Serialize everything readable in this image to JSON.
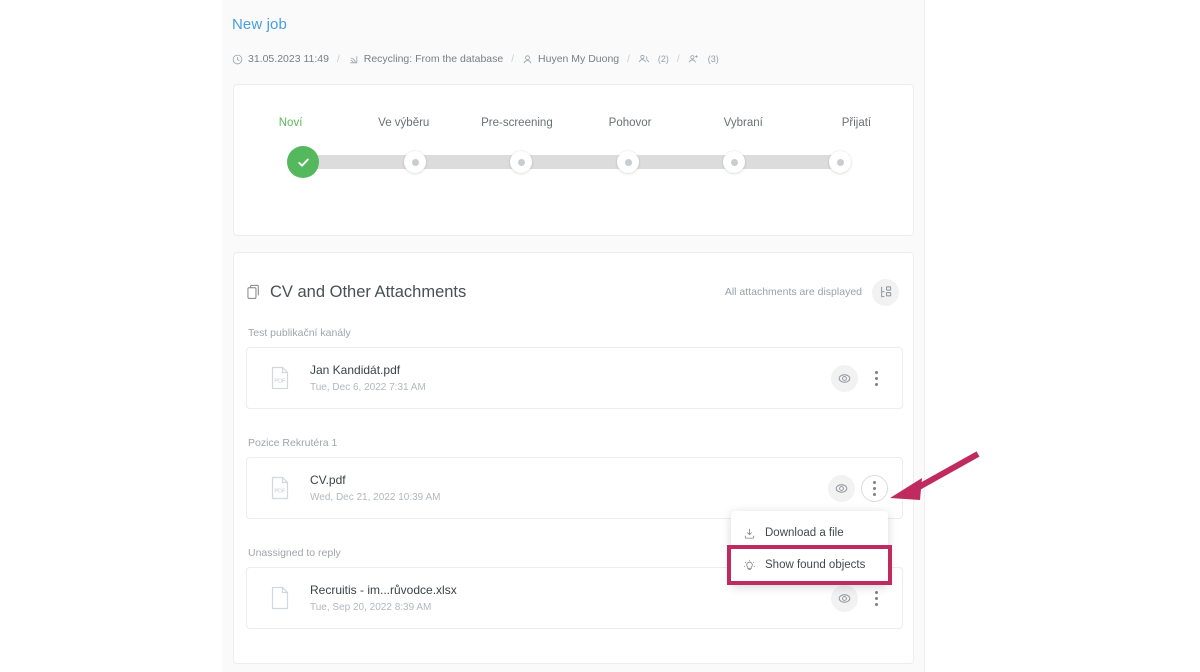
{
  "header": {
    "job_title": "New job",
    "breadcrumb": [
      {
        "icon": "clock-icon",
        "label": "31.05.2023 11:49",
        "count": ""
      },
      {
        "icon": "rss-feed-icon",
        "label": "Recycling: From the database",
        "count": ""
      },
      {
        "icon": "user-icon",
        "label": "Huyen My Duong",
        "count": ""
      },
      {
        "icon": "users-icon",
        "label": "",
        "count": "(2)"
      },
      {
        "icon": "user-add-icon",
        "label": "",
        "count": "(3)"
      }
    ],
    "separator": "/"
  },
  "stepper": {
    "active_index": 0,
    "active_color": "#5cb85c",
    "steps": [
      {
        "label": "Noví"
      },
      {
        "label": "Ve výběru"
      },
      {
        "label": "Pre-screening"
      },
      {
        "label": "Pohovor"
      },
      {
        "label": "Vybraní"
      },
      {
        "label": "Přijatí"
      }
    ]
  },
  "attachments": {
    "title": "CV and Other Attachments",
    "title_icon": "documents-icon",
    "status_note": "All attachments are displayed",
    "layout_icon": "layout-toggle-icon",
    "groups": [
      {
        "label": "Test publikační kanály",
        "files": [
          {
            "icon": "pdf-file-icon",
            "name": "Jan Kandidát.pdf",
            "date": "Tue, Dec 6, 2022 7:31 AM",
            "eye_icon": "eye-icon",
            "menu_icon": "kebab-menu-icon",
            "menu_open": false
          }
        ]
      },
      {
        "label": "Pozice Rekrutéra 1",
        "files": [
          {
            "icon": "pdf-file-icon",
            "name": "CV.pdf",
            "date": "Wed, Dec 21, 2022 10:39 AM",
            "eye_icon": "eye-icon",
            "menu_icon": "kebab-menu-icon",
            "menu_open": true
          }
        ]
      },
      {
        "label": "Unassigned to reply",
        "files": [
          {
            "icon": "generic-file-icon",
            "name": "Recruitis - im...růvodce.xlsx",
            "date": "Tue, Sep 20, 2022 8:39 AM",
            "eye_icon": "eye-icon",
            "menu_icon": "kebab-menu-icon",
            "menu_open": false
          }
        ]
      }
    ]
  },
  "context_menu": {
    "items": [
      {
        "icon": "download-icon",
        "label": "Download a file",
        "highlighted": false
      },
      {
        "icon": "lightbulb-icon",
        "label": "Show found objects",
        "highlighted": true
      }
    ],
    "highlight_color": "#bf2b5e"
  },
  "annotation": {
    "arrow_color": "#bf2b5e",
    "points_to": "kebab-menu-icon"
  }
}
